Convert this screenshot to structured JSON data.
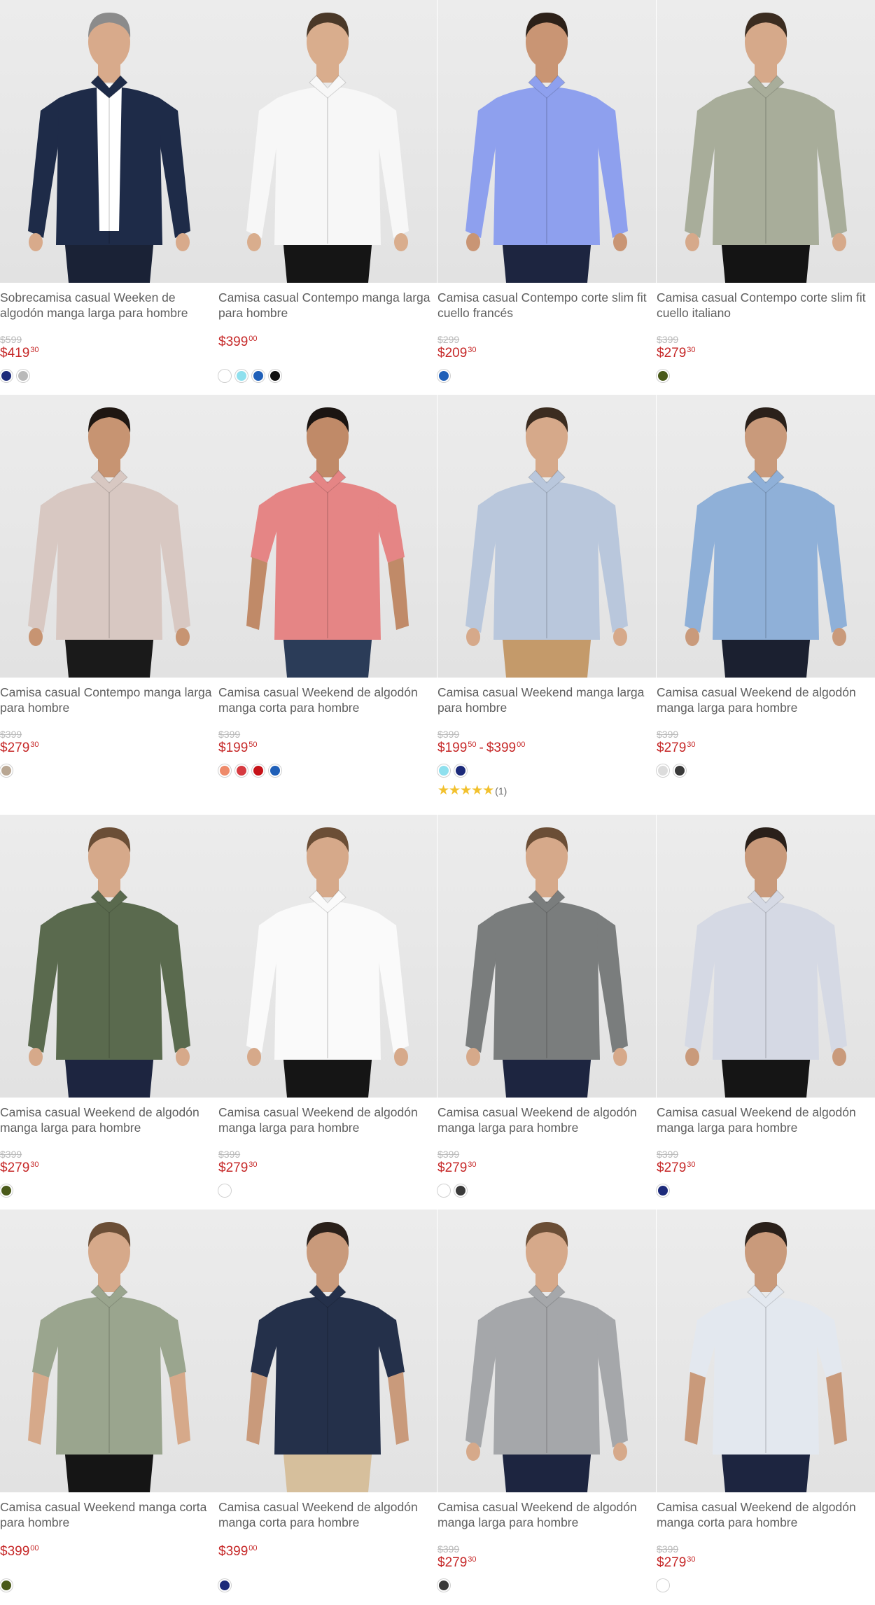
{
  "products": [
    {
      "title": "Sobrecamisa casual Weeken de algodón manga larga para hombre",
      "old_price": "$599",
      "price_int": "$419",
      "price_dec": "30",
      "swatches": [
        "#1c2a7a",
        "#b9b9b9"
      ],
      "shirt": "#1e2b48",
      "skin": "#d8aa8b",
      "hair": "#8b8b8b",
      "pants": "#1a2236",
      "undershirt": "#ffffff"
    },
    {
      "title": "Camisa casual Contempo manga larga para hombre",
      "old_price": "",
      "price_int": "$399",
      "price_dec": "00",
      "swatches": [
        "#ffffff",
        "#8fe0ee",
        "#1f5fb8",
        "#111111"
      ],
      "shirt": "#f7f7f7",
      "skin": "#d9ad8d",
      "hair": "#4a3828",
      "pants": "#151515"
    },
    {
      "title": "Camisa casual Contempo corte slim fit cuello francés",
      "old_price": "$299",
      "price_int": "$209",
      "price_dec": "30",
      "swatches": [
        "#1f5fb8"
      ],
      "shirt": "#8ea0ee",
      "skin": "#c99574",
      "hair": "#2c2018",
      "pants": "#1d2540"
    },
    {
      "title": "Camisa casual Contempo corte slim fit cuello italiano",
      "old_price": "$399",
      "price_int": "$279",
      "price_dec": "30",
      "swatches": [
        "#4a5a1a"
      ],
      "shirt": "#a8ad9a",
      "skin": "#d6a98a",
      "hair": "#3b2c20",
      "pants": "#141414"
    },
    {
      "title": "Camisa casual Contempo manga larga para hombre",
      "old_price": "$399",
      "price_int": "$279",
      "price_dec": "30",
      "swatches": [
        "#b9a793"
      ],
      "shirt": "#d8c8c2",
      "skin": "#c79472",
      "hair": "#1f1712",
      "pants": "#1a1a1a"
    },
    {
      "title": "Camisa casual Weekend de algodón manga corta para hombre",
      "old_price": "$399",
      "price_int": "$199",
      "price_dec": "50",
      "swatches": [
        "#ee8a6a",
        "#d63a40",
        "#c61218",
        "#1f5fb8"
      ],
      "shirt": "#e58585",
      "skin": "#c08a68",
      "hair": "#1b1512",
      "pants": "#2b3c58",
      "short": true
    },
    {
      "title": "Camisa casual Weekend manga larga para hombre",
      "old_price": "$399",
      "price_int": "$199",
      "price_dec": "50",
      "price2_int": "$399",
      "price2_dec": "00",
      "swatches": [
        "#8fe0ee",
        "#1c2a7a"
      ],
      "rating_stars": "★★★★★",
      "rating_count": "(1)",
      "shirt": "#b9c7dc",
      "skin": "#d6a98a",
      "hair": "#3b2c20",
      "pants": "#c49a6a"
    },
    {
      "title": "Camisa casual Weekend de algodón manga larga para hombre",
      "old_price": "$399",
      "price_int": "$279",
      "price_dec": "30",
      "swatches": [
        "#dcdcdc",
        "#3a3a3a"
      ],
      "shirt": "#8fb0d8",
      "skin": "#c99a7b",
      "hair": "#2a201a",
      "pants": "#1b2030"
    },
    {
      "title": "Camisa casual Weekend de algodón manga larga para hombre",
      "old_price": "$399",
      "price_int": "$279",
      "price_dec": "30",
      "swatches": [
        "#4a5a1a"
      ],
      "shirt": "#5a6a4e",
      "skin": "#d6a98a",
      "hair": "#6b4e36",
      "pants": "#1d2540"
    },
    {
      "title": "Camisa casual Weekend de algodón manga larga para hombre",
      "old_price": "$399",
      "price_int": "$279",
      "price_dec": "30",
      "swatches": [
        "#ffffff"
      ],
      "shirt": "#fafafa",
      "skin": "#d6a98a",
      "hair": "#6b4e36",
      "pants": "#151515"
    },
    {
      "title": "Camisa casual Weekend de algodón manga larga para hombre",
      "old_price": "$399",
      "price_int": "$279",
      "price_dec": "30",
      "swatches": [
        "#ffffff",
        "#3a3a3a"
      ],
      "shirt": "#7a7d7d",
      "skin": "#d6a98a",
      "hair": "#6b4e36",
      "pants": "#1d2540"
    },
    {
      "title": "Camisa casual Weekend de algodón manga larga para hombre",
      "old_price": "$399",
      "price_int": "$279",
      "price_dec": "30",
      "swatches": [
        "#1c2a7a"
      ],
      "shirt": "#d5d9e4",
      "skin": "#c99a7b",
      "hair": "#2a201a",
      "pants": "#151515"
    },
    {
      "title": "Camisa casual Weekend manga corta para hombre",
      "old_price": "",
      "price_int": "$399",
      "price_dec": "00",
      "swatches": [
        "#4a5a1a"
      ],
      "shirt": "#9aa58e",
      "skin": "#d6a98a",
      "hair": "#6b4e36",
      "pants": "#151515",
      "short": true
    },
    {
      "title": "Camisa casual Weekend de algodón manga corta para hombre",
      "old_price": "",
      "price_int": "$399",
      "price_dec": "00",
      "swatches": [
        "#1c2a7a"
      ],
      "shirt": "#24304a",
      "skin": "#c99a7b",
      "hair": "#2a201a",
      "pants": "#d6bf9c",
      "short": true
    },
    {
      "title": "Camisa casual Weekend de algodón manga larga para hombre",
      "old_price": "$399",
      "price_int": "$279",
      "price_dec": "30",
      "swatches": [
        "#3a3a3a"
      ],
      "shirt": "#a5a7aa",
      "skin": "#d6a98a",
      "hair": "#6b4e36",
      "pants": "#1d2540"
    },
    {
      "title": "Camisa casual Weekend de algodón manga corta para hombre",
      "old_price": "$399",
      "price_int": "$279",
      "price_dec": "30",
      "swatches": [
        "#ffffff"
      ],
      "shirt": "#e3e8ef",
      "skin": "#c99a7b",
      "hair": "#2a201a",
      "pants": "#1d2540",
      "short": true
    }
  ]
}
